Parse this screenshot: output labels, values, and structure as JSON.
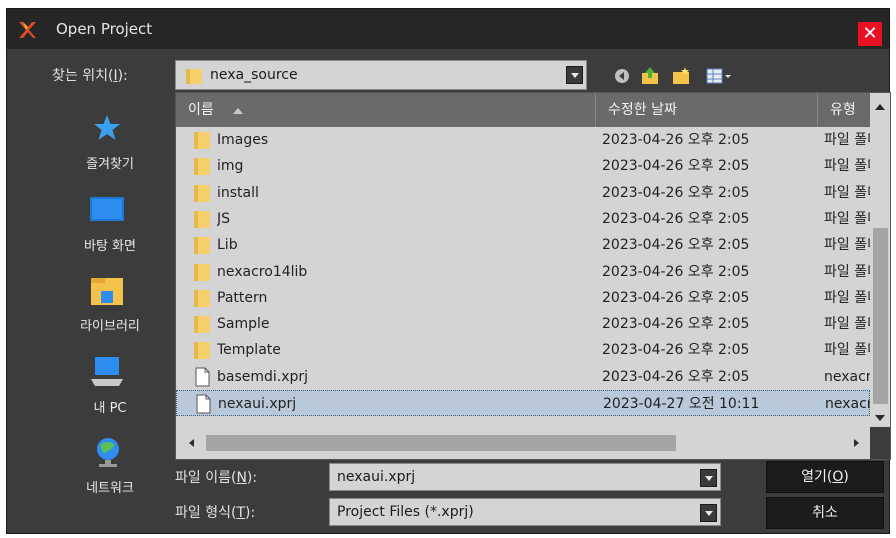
{
  "window": {
    "title": "Open Project",
    "close_glyph": "✕"
  },
  "lookin": {
    "label_pre": "찾는 위치(",
    "label_key": "I",
    "label_post": "):",
    "value": "nexa_source"
  },
  "toolbar": {
    "icons": [
      "back-icon",
      "up-folder-icon",
      "new-folder-icon",
      "view-menu-icon"
    ]
  },
  "places": [
    {
      "label": "즐겨찾기",
      "icon": "star-icon"
    },
    {
      "label": "바탕 화면",
      "icon": "desktop-icon"
    },
    {
      "label": "라이브러리",
      "icon": "library-icon"
    },
    {
      "label": "내 PC",
      "icon": "pc-icon"
    },
    {
      "label": "네트워크",
      "icon": "network-icon"
    }
  ],
  "columns": {
    "name": "이름",
    "date": "수정한 날짜",
    "type": "유형"
  },
  "files": [
    {
      "name": "Images",
      "date": "2023-04-26 오후 2:05",
      "type": "파일 폴더",
      "kind": "folder"
    },
    {
      "name": "img",
      "date": "2023-04-26 오후 2:05",
      "type": "파일 폴더",
      "kind": "folder"
    },
    {
      "name": "install",
      "date": "2023-04-26 오후 2:05",
      "type": "파일 폴더",
      "kind": "folder"
    },
    {
      "name": "JS",
      "date": "2023-04-26 오후 2:05",
      "type": "파일 폴더",
      "kind": "folder"
    },
    {
      "name": "Lib",
      "date": "2023-04-26 오후 2:05",
      "type": "파일 폴더",
      "kind": "folder"
    },
    {
      "name": "nexacro14lib",
      "date": "2023-04-26 오후 2:05",
      "type": "파일 폴더",
      "kind": "folder"
    },
    {
      "name": "Pattern",
      "date": "2023-04-26 오후 2:05",
      "type": "파일 폴더",
      "kind": "folder"
    },
    {
      "name": "Sample",
      "date": "2023-04-26 오후 2:05",
      "type": "파일 폴더",
      "kind": "folder"
    },
    {
      "name": "Template",
      "date": "2023-04-26 오후 2:05",
      "type": "파일 폴더",
      "kind": "folder"
    },
    {
      "name": "basemdi.xprj",
      "date": "2023-04-26 오후 2:05",
      "type": "nexacro",
      "kind": "file"
    },
    {
      "name": "nexaui.xprj",
      "date": "2023-04-27 오전 10:11",
      "type": "nexacro",
      "kind": "file",
      "selected": true
    }
  ],
  "filename": {
    "label_pre": "파일 이름(",
    "label_key": "N",
    "label_post": "):",
    "value": "nexaui.xprj"
  },
  "filetype": {
    "label_pre": "파일 형식(",
    "label_key": "T",
    "label_post": "):",
    "value": "Project Files (*.xprj)"
  },
  "buttons": {
    "open_pre": "열기(",
    "open_key": "O",
    "open_post": ")",
    "cancel": "취소"
  }
}
